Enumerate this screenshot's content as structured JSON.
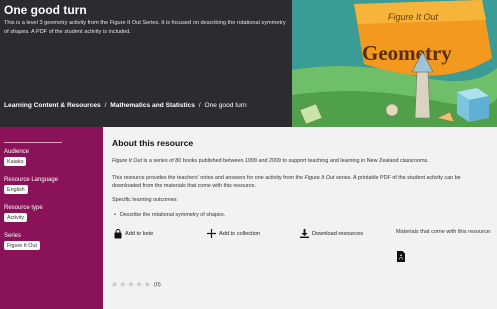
{
  "header": {
    "title": "One good turn",
    "description": "This is a level 3 geometry activity from the Figure It Out Series. It is focused on describing the rotational symmetry of shapes. A PDF of the student activity is included.",
    "breadcrumb": [
      "Learning Content & Resources",
      "Mathematics and Statistics",
      "One good turn"
    ],
    "breadcrumb_separator": "/"
  },
  "cover": {
    "series_text": "Figure It Out",
    "subject_text": "Geometry"
  },
  "sidebar": {
    "audience_label": "Audience",
    "audience_value": "Kaiako",
    "language_label": "Resource Language",
    "language_value": "English",
    "type_label": "Resource type",
    "type_value": "Activity",
    "series_label": "Series",
    "series_value": "Figure It Out"
  },
  "main": {
    "heading": "About this resource",
    "p1_italic": "Figure It Out",
    "p1_rest": " is a series of 80 books published between 1999 and 2009 to support teaching and learning in New Zealand classrooms.",
    "p2_a": "This resource provides the teachers' notes and answers for one activity from the ",
    "p2_italic": "Figure It Out",
    "p2_b": " series. A printable PDF of the student activity can be",
    "p2_line2": "downloaded from the materials that come with this resource.",
    "outcomes_label": "Specific learning outcomes:",
    "outcome_1": "Describe the rotational symmetry of shapes.",
    "add_kete": "Add to kete",
    "add_collection": "Add to collection",
    "download": "Download resources",
    "materials_label": "Materials that come with this resource:",
    "rating_count": "(0)"
  },
  "colors": {
    "header_bg": "#2b2b30",
    "sidebar_bg": "#8a1259",
    "main_bg": "#f2f2f2",
    "cover_bg": "#3a9c94",
    "cover_banner": "#f39a1e"
  }
}
